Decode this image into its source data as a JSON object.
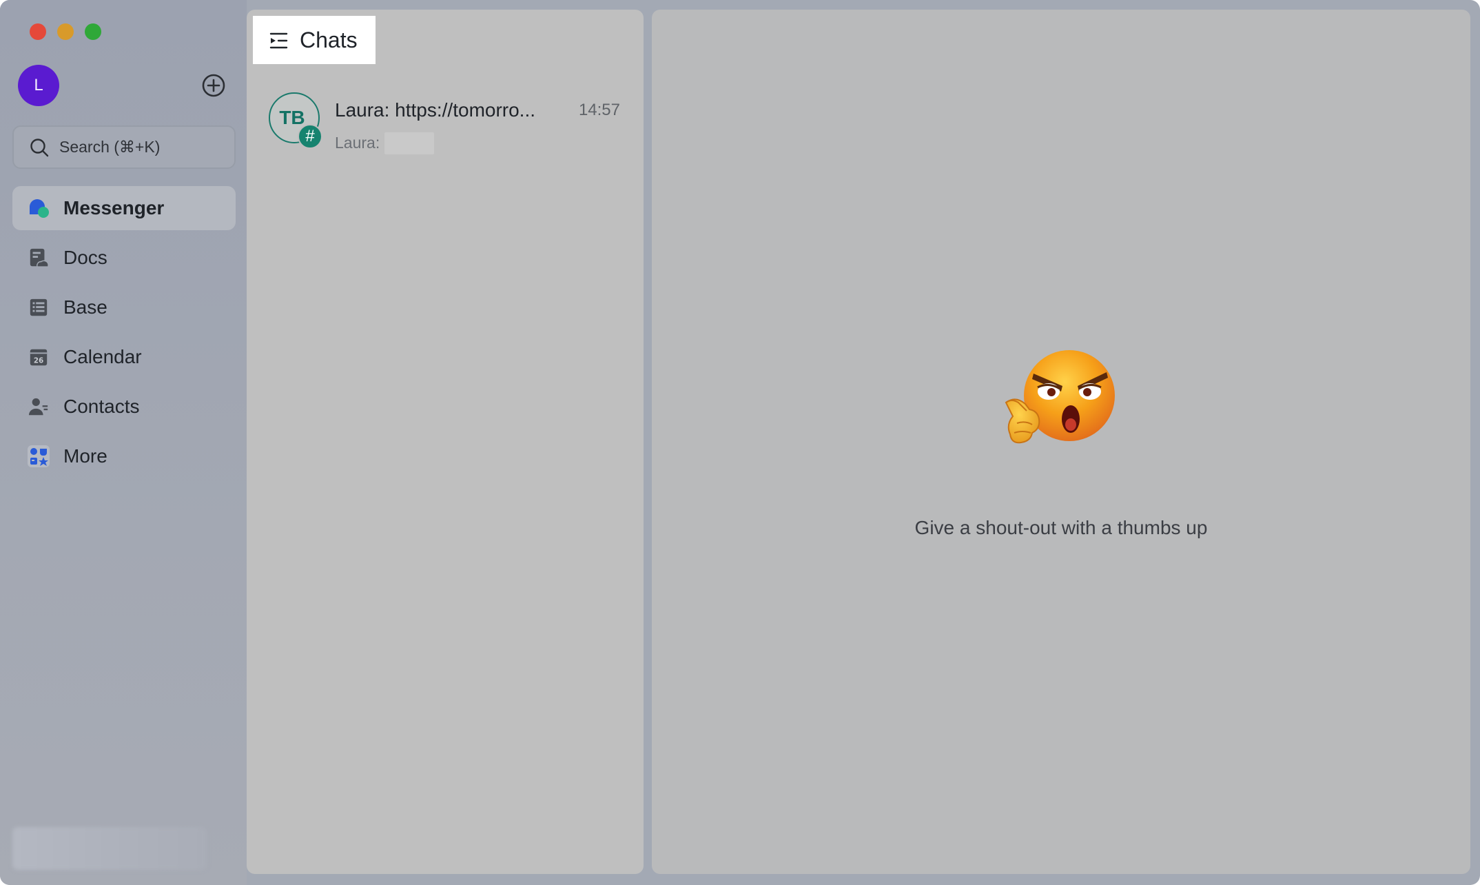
{
  "window": {
    "traffic_lights": {
      "close": "#e5493a",
      "minimize": "#d89a2a",
      "maximize": "#2fa838"
    }
  },
  "sidebar": {
    "avatar_initial": "L",
    "avatar_color": "#5a1bd0",
    "add_icon": "plus-circle-icon",
    "search": {
      "placeholder": "Search (⌘+K)",
      "icon": "search-icon"
    },
    "nav": [
      {
        "label": "Messenger",
        "icon": "messenger-icon",
        "active": true
      },
      {
        "label": "Docs",
        "icon": "docs-icon",
        "active": false
      },
      {
        "label": "Base",
        "icon": "base-icon",
        "active": false
      },
      {
        "label": "Calendar",
        "icon": "calendar-icon",
        "calendar_day": "26",
        "active": false
      },
      {
        "label": "Contacts",
        "icon": "contacts-icon",
        "active": false
      },
      {
        "label": "More",
        "icon": "more-apps-icon",
        "active": false
      }
    ]
  },
  "chat_list": {
    "header_label": "Chats",
    "header_icon": "chat-list-toggle-icon",
    "items": [
      {
        "avatar_initials": "TB",
        "badge_symbol": "#",
        "title": "Laura: https://tomorro...",
        "time": "14:57",
        "preview_sender": "Laura:",
        "accent": "#16836f"
      }
    ]
  },
  "main": {
    "empty_state_icon": "angry-thinking-emoji-icon",
    "empty_state_text": "Give a shout-out with a thumbs up"
  }
}
